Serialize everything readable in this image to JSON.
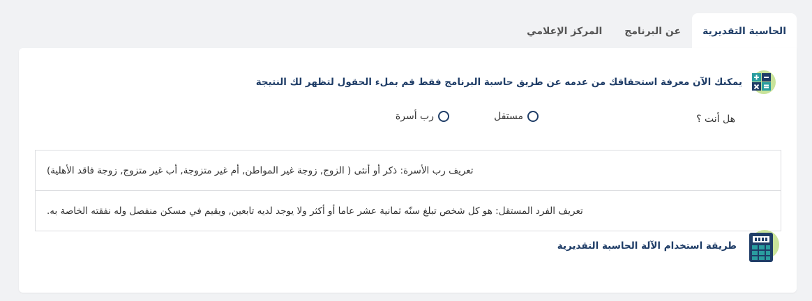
{
  "tabs": [
    {
      "label": "الحاسبة التقديرية",
      "active": true
    },
    {
      "label": "عن البرنامج",
      "active": false
    },
    {
      "label": "المركز الإعلامي",
      "active": false
    }
  ],
  "intro": {
    "icon": "calculator-icon",
    "text": "يمكنك الآن معرفة استحقاقك من عدمه عن طريق حاسبة البرنامج فقط قم بملء الحقول لتظهر لك النتيجة"
  },
  "question": {
    "label": "هل أنت ؟",
    "options": [
      "مستقل",
      "رب أسرة"
    ]
  },
  "definitions": [
    "تعريف رب الأسرة: ذكر أو أنثى ( الزوج, زوجة غير المواطن, أم غير متزوجة, أب غير متزوج, زوجة فاقد الأهلية)",
    "تعريف الفرد المستقل: هو كل شخص تبلغ سنّه ثمانية عشر عاما أو أكثر ولا يوجد لديه تابعين, ويقيم في مسكن منفصل وله نفقته الخاصة به."
  ],
  "usage": {
    "icon": "calculator-icon",
    "text": "طريقة استخدام الآلة الحاسبة التقديرية"
  },
  "colors": {
    "primary": "#1f3d67",
    "accent_green": "#8dc63f",
    "teal": "#2a9d9f"
  }
}
